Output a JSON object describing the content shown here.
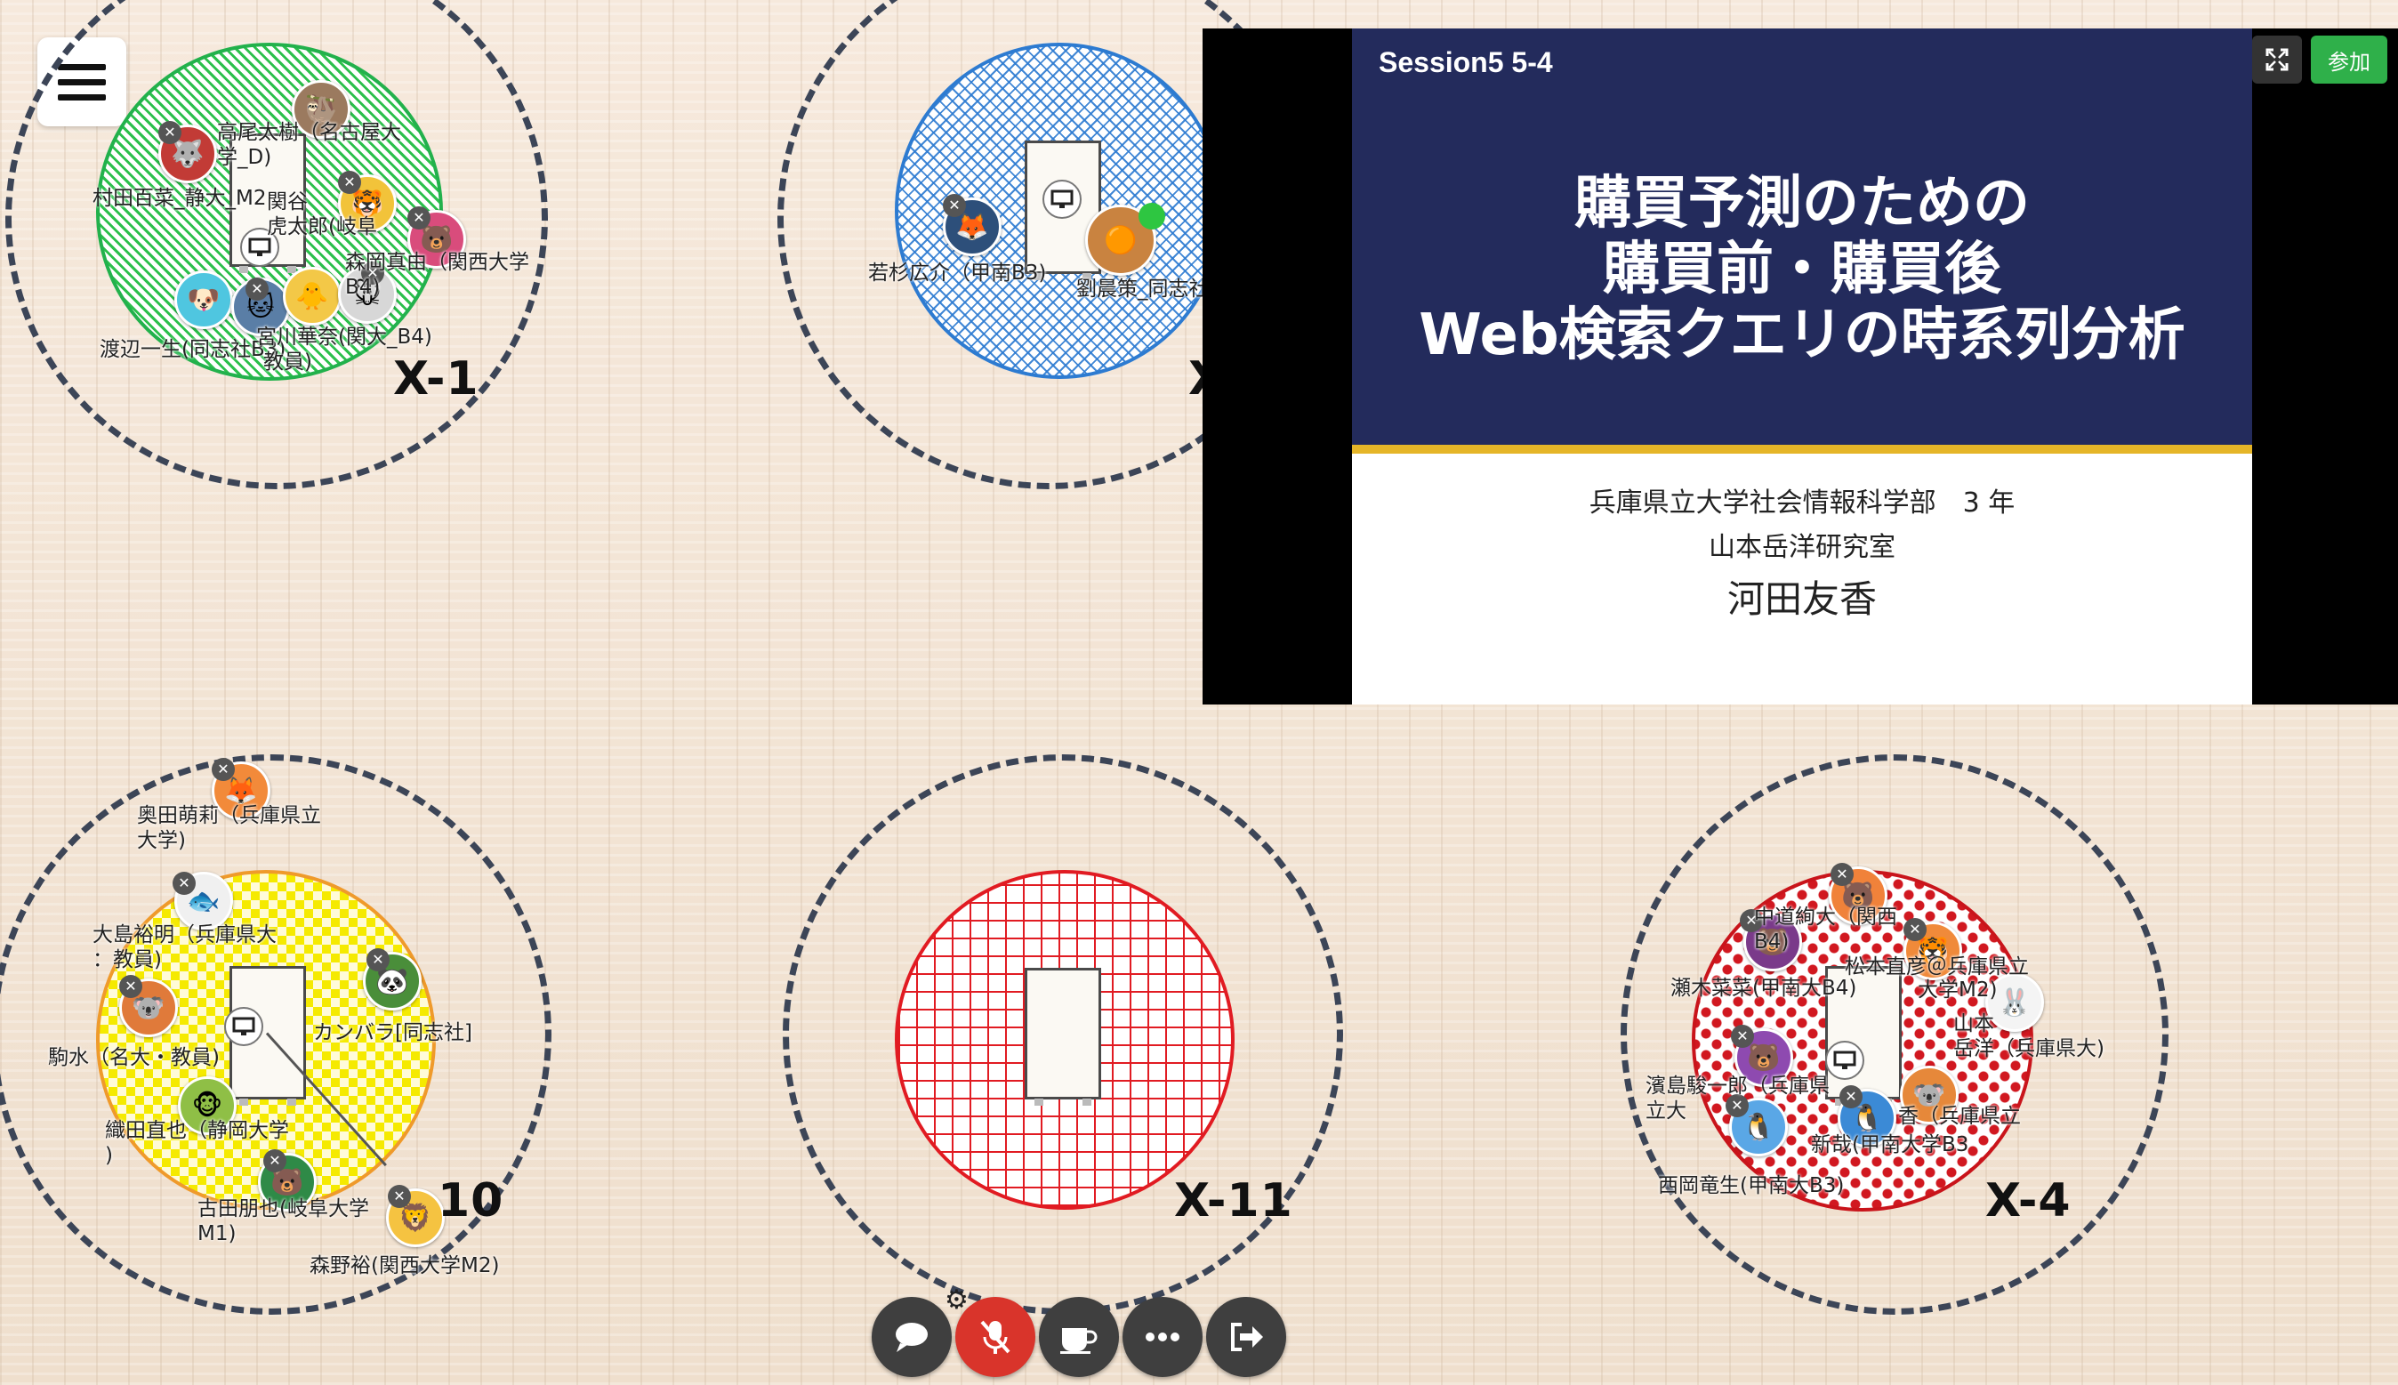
{
  "app": {
    "menu_label": "menu"
  },
  "tables": {
    "x1": {
      "label": "X-1"
    },
    "x2": {
      "label": "X"
    },
    "x10": {
      "label": "10"
    },
    "x11": {
      "label": "X-11"
    },
    "x4": {
      "label": "X-4"
    }
  },
  "participants": {
    "x1": [
      "高尾太樹（名古屋大\n学_D)",
      "村田百菜_静大_M2",
      "関谷\n虎太郎(岐阜",
      "森岡真由（関西大学\nB4)",
      "渡辺一生(同志社B3)",
      "宮川華奈(関大_B4)",
      "教員)"
    ],
    "x2": [
      "若杉広介（甲南B3)",
      "劉晨策_同志社B"
    ],
    "x10": [
      "奥田萌莉（兵庫県立\n大学)",
      "大島裕明（兵庫県大\n：教員)",
      "カンバラ[同志社]",
      "駒水（名大・教員)",
      "織田直也（静岡大学\n)",
      "古田朋也(岐阜大学\nM1)",
      "森野裕(関西大学M2)"
    ],
    "x4": [
      "中道絢大（関西\nB4)",
      "松本直彦＠兵庫県立",
      "瀬木菜菜(甲南大B4)",
      "大学M2)",
      "山本\n岳洋（兵庫県大)",
      "濱島駿一郎（兵庫県\n立大",
      "香（兵庫県立",
      "新哉(甲南大学B3",
      "西岡竜生(甲南大B3)"
    ]
  },
  "video_panel": {
    "session_tag": "Session5 5-4",
    "title_lines": [
      "購買予測のための",
      "購買前・購買後",
      "Web検索クエリの時系列分析"
    ],
    "affiliation": "兵庫県立大学社会情報科学部　3 年",
    "lab": "山本岳洋研究室",
    "presenter": "河田友香",
    "expand_icon": "expand-icon",
    "join_label": "参加"
  },
  "toolbar": {
    "buttons": [
      "chat-icon",
      "mic-muted-icon",
      "coffee-icon",
      "more-icon",
      "exit-icon"
    ],
    "settings_icon": "gear-icon"
  },
  "colors": {
    "ring": "#3c4557",
    "slide_header": "#232b5c",
    "slide_accent": "#e5b528",
    "join_button": "#2fb04a",
    "mute_red": "#d9342b"
  }
}
